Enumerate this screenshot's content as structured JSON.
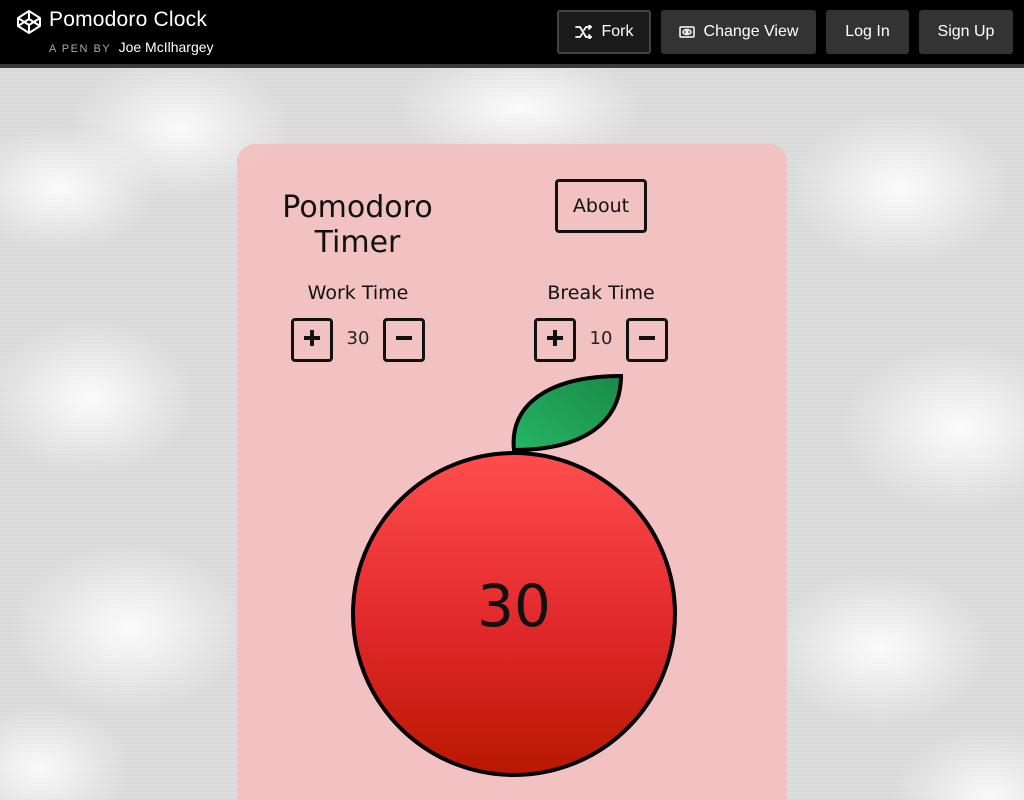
{
  "header": {
    "title": "Pomodoro Clock",
    "byline_prefix": "A PEN BY",
    "author": "Joe McIlhargey",
    "buttons": {
      "fork": "Fork",
      "change_view": "Change View",
      "log_in": "Log In",
      "sign_up": "Sign Up"
    }
  },
  "app": {
    "title_line1": "Pomodoro",
    "title_line2": "Timer",
    "about_label": "About",
    "work": {
      "label": "Work Time",
      "value": "30"
    },
    "break": {
      "label": "Break Time",
      "value": "10"
    },
    "timer_value": "30"
  },
  "colors": {
    "card_bg": "#f5bebe",
    "apple_top": "#ff4d4d",
    "apple_bottom": "#b81800",
    "leaf": "#1fa158",
    "topbar": "#000000"
  },
  "icons": {
    "logo": "codepen-logo-icon",
    "fork": "fork-icon",
    "view": "eye-icon",
    "plus": "plus-icon",
    "minus": "minus-icon"
  }
}
